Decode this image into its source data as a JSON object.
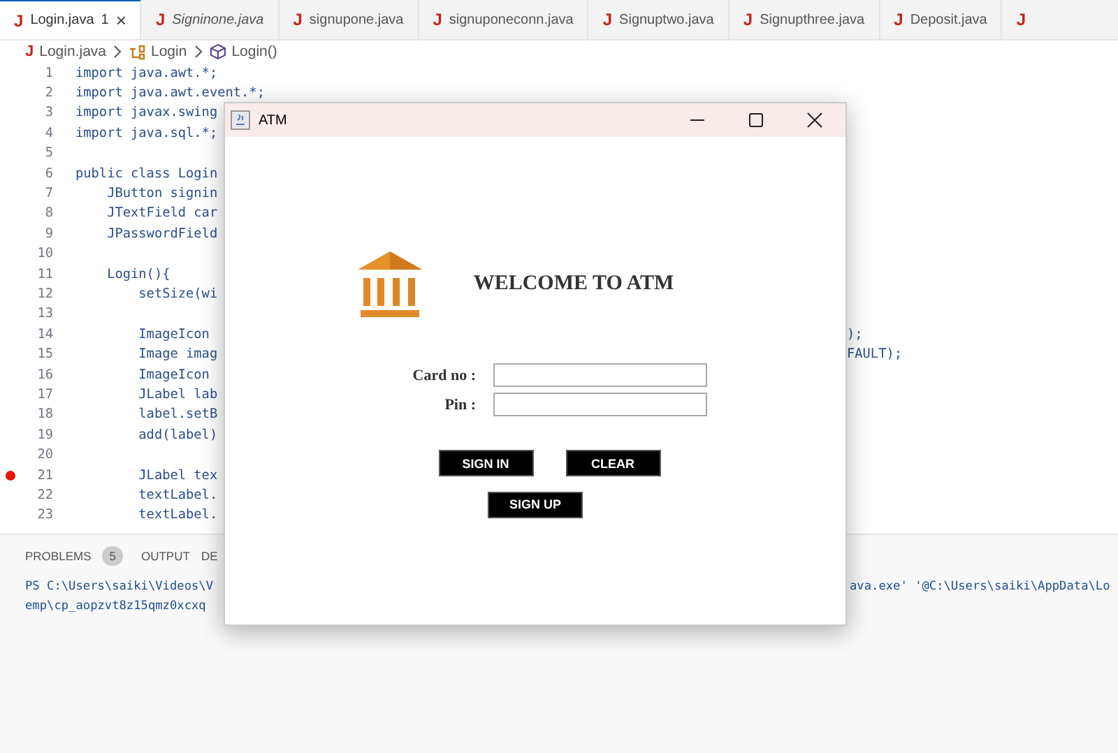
{
  "tabs": [
    {
      "icon": "J",
      "label": "Login.java",
      "badge": "1",
      "close": "×",
      "selected": true,
      "preview": false
    },
    {
      "icon": "J",
      "label": "Signinone.java",
      "selected": false,
      "preview": true
    },
    {
      "icon": "J",
      "label": "signupone.java",
      "selected": false,
      "preview": false
    },
    {
      "icon": "J",
      "label": "signuponeconn.java",
      "selected": false,
      "preview": false
    },
    {
      "icon": "J",
      "label": "Signuptwo.java",
      "selected": false,
      "preview": false
    },
    {
      "icon": "J",
      "label": "Signupthree.java",
      "selected": false,
      "preview": false
    },
    {
      "icon": "J",
      "label": "Deposit.java",
      "selected": false,
      "preview": false
    },
    {
      "icon": "J",
      "selected": false
    }
  ],
  "breadcrumb": {
    "icon": "J",
    "items": [
      {
        "kind": "file",
        "label": "Login.java"
      },
      {
        "kind": "class",
        "label": "Login"
      },
      {
        "kind": "method",
        "label": "Login()"
      }
    ]
  },
  "code_lines": [
    {
      "number": "1",
      "text": "import java.awt.*;",
      "breakpoint": false
    },
    {
      "number": "2",
      "text": "import java.awt.event.*;",
      "breakpoint": false
    },
    {
      "number": "3",
      "text": "import javax.swing",
      "breakpoint": false
    },
    {
      "number": "4",
      "text": "import java.sql.*;",
      "breakpoint": false
    },
    {
      "number": "5",
      "breakpoint": false
    },
    {
      "number": "6",
      "text": "public class Login",
      "breakpoint": false
    },
    {
      "number": "7",
      "text": "    JButton signin",
      "breakpoint": false
    },
    {
      "number": "8",
      "text": "    JTextField car",
      "breakpoint": false
    },
    {
      "number": "9",
      "text": "    JPasswordField",
      "breakpoint": false
    },
    {
      "number": "10",
      "breakpoint": false
    },
    {
      "number": "11",
      "text": "    Login(){",
      "breakpoint": false
    },
    {
      "number": "12",
      "text": "        setSize(wi",
      "breakpoint": false
    },
    {
      "number": "13",
      "breakpoint": false
    },
    {
      "number": "14",
      "text": "        ImageIcon",
      "tail": ");",
      "breakpoint": false
    },
    {
      "number": "15",
      "text": "        Image imag",
      "tail": "FAULT);",
      "breakpoint": false
    },
    {
      "number": "16",
      "text": "        ImageIcon",
      "breakpoint": false
    },
    {
      "number": "17",
      "text": "        JLabel lab",
      "breakpoint": false
    },
    {
      "number": "18",
      "text": "        label.setB",
      "breakpoint": false
    },
    {
      "number": "19",
      "text": "        add(label)",
      "breakpoint": false
    },
    {
      "number": "20",
      "breakpoint": false
    },
    {
      "number": "21",
      "text": "        JLabel tex",
      "breakpoint": true
    },
    {
      "number": "22",
      "text": "        textLabel.",
      "breakpoint": false
    },
    {
      "number": "23",
      "text": "        textLabel.",
      "breakpoint": false
    }
  ],
  "panel": {
    "tabs": [
      {
        "label": "PROBLEMS",
        "count": "5",
        "selected": false
      },
      {
        "label": "OUTPUT",
        "selected": false
      },
      {
        "label": "DE",
        "selected": false
      }
    ],
    "terminal_lines": [
      {
        "text": "PS C:\\Users\\saiki\\Videos\\V",
        "tail": "ava.exe' '@C:\\Users\\saiki\\AppData\\Lo"
      },
      {
        "text": "emp\\cp_aopzvt8z15qmz0xcxq"
      }
    ]
  },
  "atm_window": {
    "title": "ATM",
    "heading": "WELCOME TO ATM",
    "fields": [
      {
        "label": "Card no :"
      },
      {
        "label": "Pin :"
      }
    ],
    "buttons": [
      {
        "label": "SIGN IN"
      },
      {
        "label": "CLEAR"
      }
    ],
    "bottom_button": {
      "label": "SIGN UP"
    }
  }
}
